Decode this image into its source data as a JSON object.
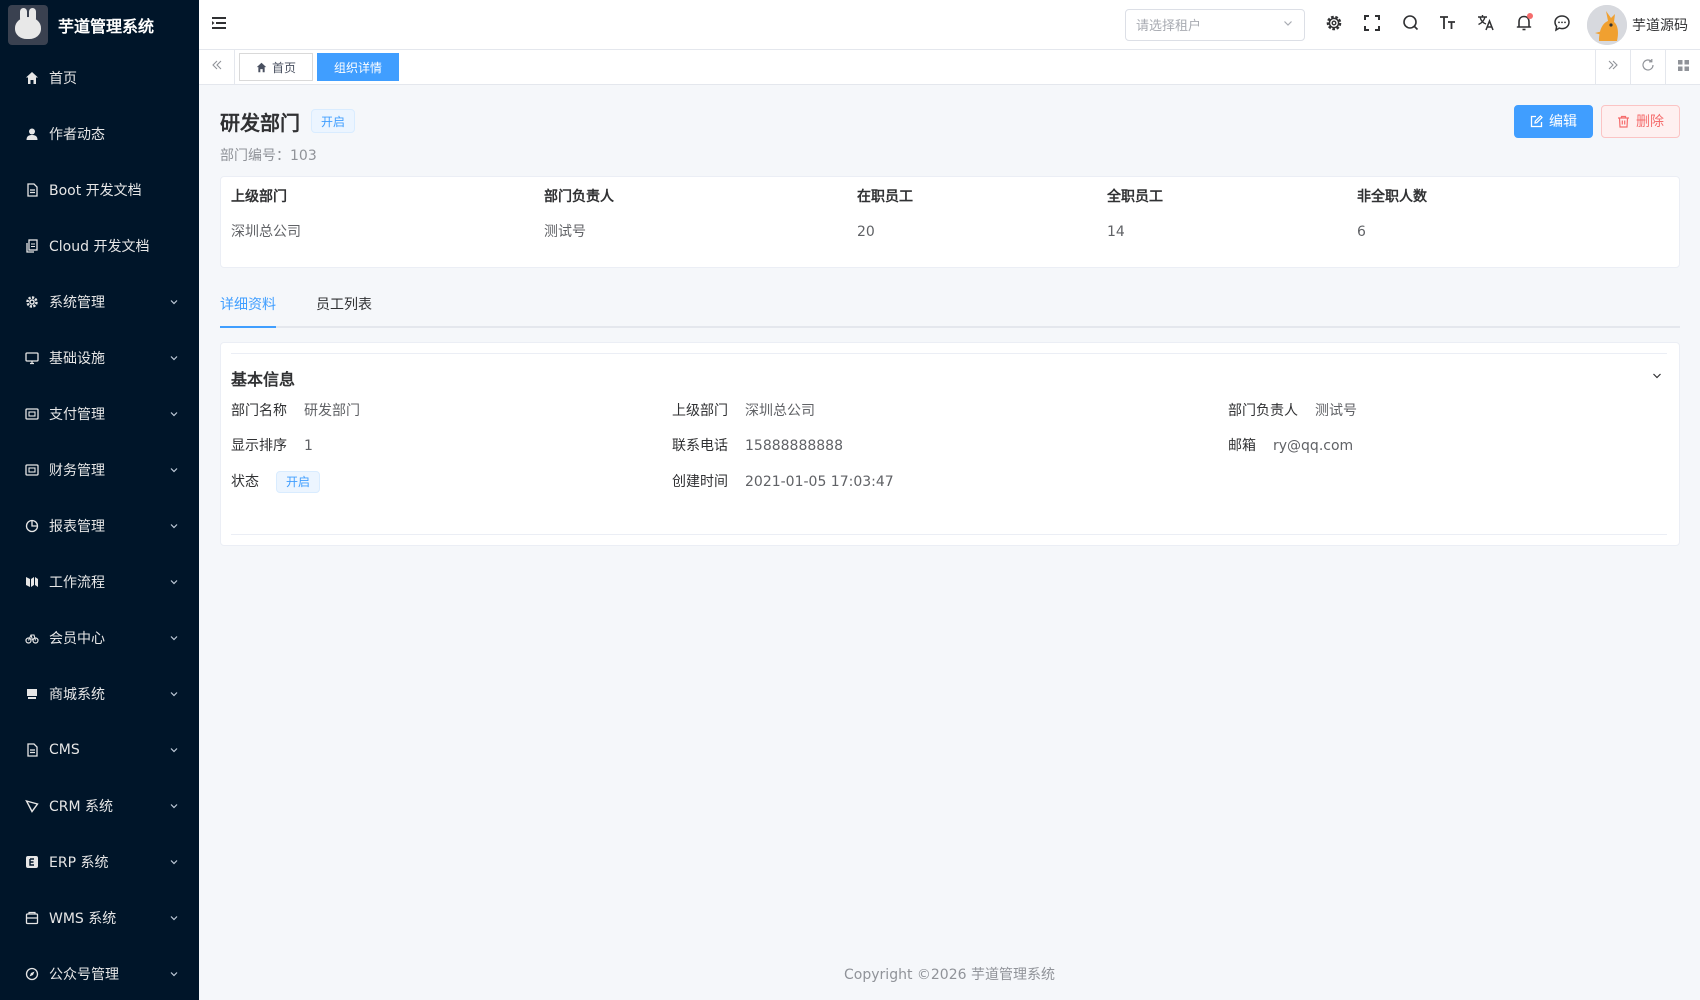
{
  "app": {
    "title": "芋道管理系统"
  },
  "sidebar": {
    "items": [
      {
        "label": "首页",
        "icon": "home-icon"
      },
      {
        "label": "作者动态",
        "icon": "user-icon"
      },
      {
        "label": "Boot 开发文档",
        "icon": "document-icon"
      },
      {
        "label": "Cloud 开发文档",
        "icon": "copy-document-icon"
      },
      {
        "label": "系统管理",
        "icon": "gear-icon"
      },
      {
        "label": "基础设施",
        "icon": "monitor-icon"
      },
      {
        "label": "支付管理",
        "icon": "wallet-icon"
      },
      {
        "label": "财务管理",
        "icon": "wallet-icon"
      },
      {
        "label": "报表管理",
        "icon": "pie-chart-icon"
      },
      {
        "label": "工作流程",
        "icon": "workflow-icon"
      },
      {
        "label": "会员中心",
        "icon": "bicycle-icon"
      },
      {
        "label": "商城系统",
        "icon": "shop-icon"
      },
      {
        "label": "CMS",
        "icon": "document-icon"
      },
      {
        "label": "CRM 系统",
        "icon": "crm-icon"
      },
      {
        "label": "ERP 系统",
        "icon": "erp-icon"
      },
      {
        "label": "WMS 系统",
        "icon": "box-icon"
      },
      {
        "label": "公众号管理",
        "icon": "compass-icon"
      }
    ]
  },
  "header": {
    "tenant_placeholder": "请选择租户",
    "user_name": "芋道源码"
  },
  "tags": {
    "home": "首页",
    "current": "组织详情"
  },
  "detail": {
    "title": "研发部门",
    "status": "开启",
    "code": "部门编号：103",
    "edit_label": "编辑",
    "delete_label": "删除"
  },
  "summary": {
    "columns": [
      {
        "label": "上级部门",
        "value": "深圳总公司"
      },
      {
        "label": "部门负责人",
        "value": "测试号"
      },
      {
        "label": "在职员工",
        "value": "20"
      },
      {
        "label": "全职员工",
        "value": "14"
      },
      {
        "label": "非全职人数",
        "value": "6"
      }
    ]
  },
  "tabs": [
    {
      "label": "详细资料"
    },
    {
      "label": "员工列表"
    }
  ],
  "basic_info": {
    "title": "基本信息",
    "dept_name_label": "部门名称",
    "dept_name": "研发部门",
    "parent_label": "上级部门",
    "parent": "深圳总公司",
    "leader_label": "部门负责人",
    "leader": "测试号",
    "sort_label": "显示排序",
    "sort": "1",
    "phone_label": "联系电话",
    "phone": "15888888888",
    "email_label": "邮箱",
    "email": "ry@qq.com",
    "status_label": "状态",
    "status": "开启",
    "created_label": "创建时间",
    "created": "2021-01-05 17:03:47"
  },
  "footer": {
    "copyright": "Copyright ©2026 芋道管理系统"
  },
  "colors": {
    "primary": "#409eff",
    "danger": "#f56c6c",
    "sidebar": "#001529"
  }
}
